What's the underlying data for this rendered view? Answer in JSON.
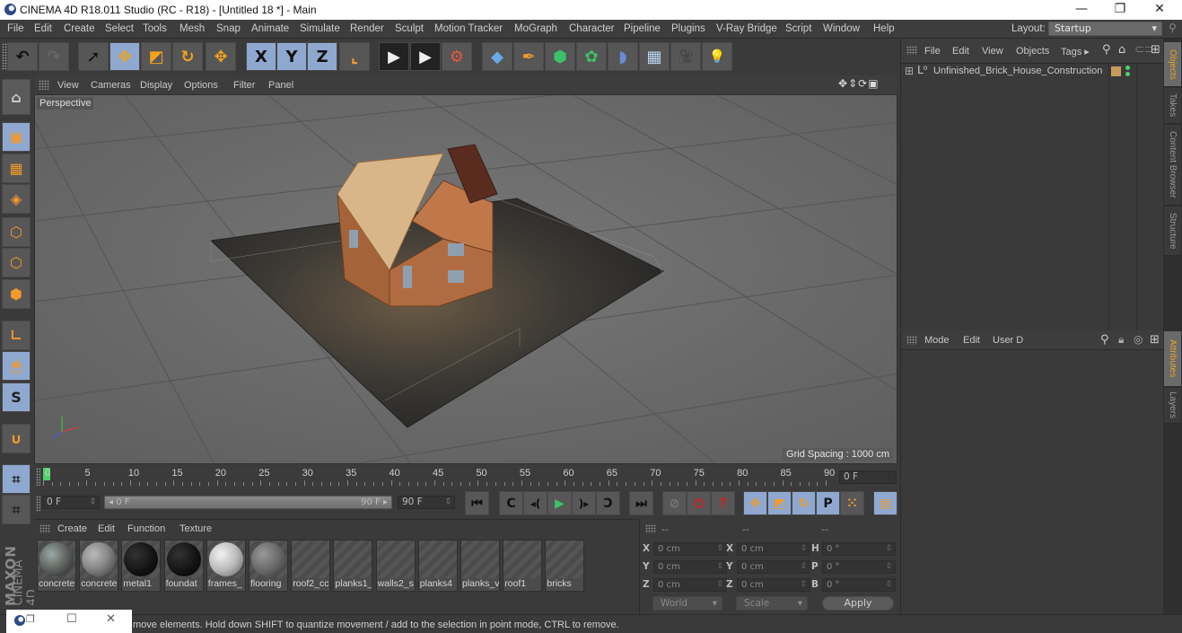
{
  "window": {
    "title": "CINEMA 4D R18.011 Studio (RC - R18) - [Untitled 18 *] - Main",
    "minimize": "—",
    "restore": "❐",
    "close": "✕"
  },
  "menubar": {
    "items": [
      "File",
      "Edit",
      "Create",
      "Select",
      "Tools",
      "Mesh",
      "Snap",
      "Animate",
      "Simulate",
      "Render",
      "Sculpt",
      "Motion Tracker",
      "MoGraph",
      "Character",
      "Pipeline",
      "Plugins",
      "V-Ray Bridge",
      "Script",
      "Window",
      "Help"
    ],
    "layout_label": "Layout:",
    "layout_value": "Startup"
  },
  "toolbar": {
    "buttons": [
      {
        "name": "undo",
        "glyph": "↶"
      },
      {
        "name": "redo",
        "glyph": "↷"
      },
      {
        "name": "live-selection",
        "glyph": "➚"
      },
      {
        "name": "move",
        "glyph": "✥"
      },
      {
        "name": "scale",
        "glyph": "◩"
      },
      {
        "name": "rotate",
        "glyph": "↻"
      },
      {
        "name": "recent-tool",
        "glyph": "✥"
      },
      {
        "name": "x-axis",
        "glyph": "X"
      },
      {
        "name": "y-axis",
        "glyph": "Y"
      },
      {
        "name": "z-axis",
        "glyph": "Z"
      },
      {
        "name": "coordinate-system",
        "glyph": "⌞"
      },
      {
        "name": "render-view",
        "glyph": "▶"
      },
      {
        "name": "render-picture-viewer",
        "glyph": "▶"
      },
      {
        "name": "render-settings",
        "glyph": "⚙"
      },
      {
        "name": "cube",
        "glyph": "◆"
      },
      {
        "name": "pen-spline",
        "glyph": "✒"
      },
      {
        "name": "subdivision-surface",
        "glyph": "⬢"
      },
      {
        "name": "array-cloner",
        "glyph": "✿"
      },
      {
        "name": "bend-deformer",
        "glyph": "◗"
      },
      {
        "name": "floor",
        "glyph": "▦"
      },
      {
        "name": "camera",
        "glyph": "🎥"
      },
      {
        "name": "light",
        "glyph": "💡"
      }
    ]
  },
  "left_tools": [
    {
      "name": "model-mode"
    },
    {
      "name": "texture-mode"
    },
    {
      "name": "workplane-mode"
    },
    {
      "name": "points-mode"
    },
    {
      "name": "edges-mode"
    },
    {
      "name": "polygons-mode"
    },
    {
      "name": "axis-mode"
    },
    {
      "name": "tweak-mode"
    },
    {
      "name": "solo-mode",
      "glyph": "S"
    },
    {
      "name": "snapping"
    },
    {
      "name": "workplane-lock"
    },
    {
      "name": "workplane-align"
    }
  ],
  "viewport": {
    "menu": [
      "View",
      "Cameras",
      "Display",
      "Options",
      "Filter",
      "Panel"
    ],
    "camera_label": "Perspective",
    "grid_spacing": "Grid Spacing : 1000 cm",
    "nav_icons": [
      "✥",
      "⇕",
      "⟳",
      "▣"
    ]
  },
  "timeline": {
    "ticks": [
      0,
      5,
      10,
      15,
      20,
      25,
      30,
      35,
      40,
      45,
      50,
      55,
      60,
      65,
      70,
      75,
      80,
      85,
      90
    ],
    "current_frame": "0 F",
    "start_field": "0 F",
    "range_start": "◂ 0 F",
    "range_end": "90 F ▸",
    "end_field": "90 F"
  },
  "transport": {
    "buttons": [
      {
        "name": "go-to-start",
        "glyph": "⏮"
      },
      {
        "name": "go-to-previous-key",
        "glyph": "C"
      },
      {
        "name": "previous-frame",
        "glyph": "◂("
      },
      {
        "name": "play-forwards",
        "glyph": "▶"
      },
      {
        "name": "next-frame",
        "glyph": ")▸"
      },
      {
        "name": "go-to-next-key",
        "glyph": "Ↄ"
      },
      {
        "name": "go-to-end",
        "glyph": "⏭"
      },
      {
        "name": "record-active-objects",
        "glyph": "⊘"
      },
      {
        "name": "autokeying",
        "glyph": "⏻"
      },
      {
        "name": "keyframe-selection",
        "glyph": "?"
      },
      {
        "name": "record-position",
        "glyph": "✥"
      },
      {
        "name": "record-scale",
        "glyph": "◩"
      },
      {
        "name": "record-rotation",
        "glyph": "↻"
      },
      {
        "name": "record-parameter",
        "glyph": "P"
      },
      {
        "name": "record-point-level",
        "glyph": "⁙"
      },
      {
        "name": "timeline-scheme",
        "glyph": "▤"
      }
    ]
  },
  "materials": {
    "menu": [
      "Create",
      "Edit",
      "Function",
      "Texture"
    ],
    "items": [
      {
        "label": "concrete",
        "preview": "mixed"
      },
      {
        "label": "concrete",
        "preview": "gray"
      },
      {
        "label": "metal1",
        "preview": "black"
      },
      {
        "label": "foundat",
        "preview": "black"
      },
      {
        "label": "frames_",
        "preview": "white"
      },
      {
        "label": "flooring",
        "preview": "mid"
      },
      {
        "label": "roof2_cc",
        "preview": "none"
      },
      {
        "label": "planks1_",
        "preview": "none"
      },
      {
        "label": "walls2_s",
        "preview": "none"
      },
      {
        "label": "planks4",
        "preview": "none"
      },
      {
        "label": "planks_v",
        "preview": "none"
      },
      {
        "label": "roof1",
        "preview": "none"
      },
      {
        "label": "bricks",
        "preview": "none"
      }
    ]
  },
  "coordinates": {
    "headers": [
      "--",
      "--",
      "--"
    ],
    "rows": [
      {
        "l1": "X",
        "v1": "0 cm",
        "l2": "X",
        "v2": "0 cm",
        "l3": "H",
        "v3": "0 °"
      },
      {
        "l1": "Y",
        "v1": "0 cm",
        "l2": "Y",
        "v2": "0 cm",
        "l3": "P",
        "v3": "0 °"
      },
      {
        "l1": "Z",
        "v1": "0 cm",
        "l2": "Z",
        "v2": "0 cm",
        "l3": "B",
        "v3": "0 °"
      }
    ],
    "space_select": "World",
    "mode_select": "Scale",
    "apply": "Apply"
  },
  "objects_panel": {
    "menu": [
      "File",
      "Edit",
      "View",
      "Objects",
      "Tags ▸"
    ],
    "objects": [
      {
        "name": "Unfinished_Brick_House_Construction",
        "tag_color": "#c79a5a"
      }
    ]
  },
  "attributes_panel": {
    "menu": [
      "Mode",
      "Edit",
      "User D"
    ]
  },
  "side_tabs": {
    "top": [
      {
        "label": "Objects",
        "active": true
      },
      {
        "label": "Takes",
        "active": false
      },
      {
        "label": "Content Browser",
        "active": false
      },
      {
        "label": "Structure",
        "active": false
      }
    ],
    "bottom": [
      {
        "label": "Attributes",
        "active": true
      },
      {
        "label": "Layers",
        "active": false
      }
    ]
  },
  "status_bar": {
    "text": "move elements. Hold down SHIFT to quantize movement / add to the selection in point mode, CTRL to remove."
  },
  "branding": {
    "line1": "MAXON",
    "line2": "CINEMA 4D"
  },
  "taskbar_popup": {
    "restore": "❐",
    "maximize": "☐",
    "close": "✕"
  },
  "colors": {
    "accent_active": "#8fa8cf",
    "tool_orange": "#f39a2a",
    "tab_active_text": "#e8a32a"
  }
}
